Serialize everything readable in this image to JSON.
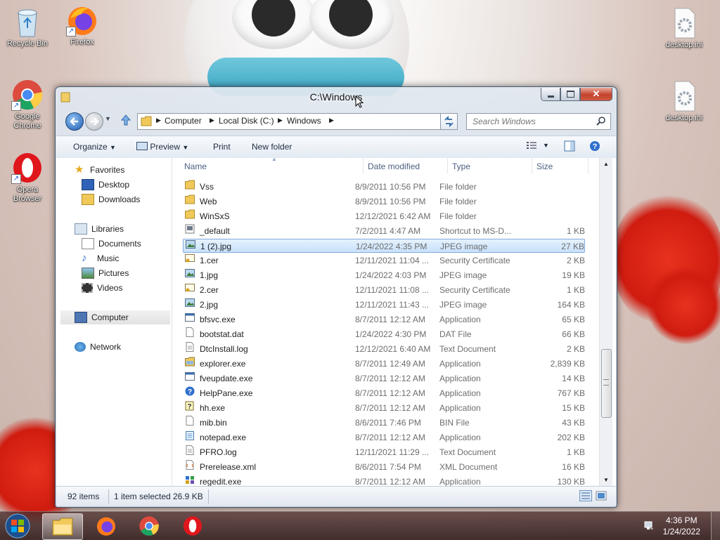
{
  "desktop": {
    "icons": [
      {
        "label": "Recycle Bin"
      },
      {
        "label": "Firefox"
      },
      {
        "label": "Google Chrome"
      },
      {
        "label": "Opera Browser"
      },
      {
        "label": "desktop.ini"
      },
      {
        "label": "desktop.ini"
      }
    ]
  },
  "window": {
    "title": "C:\\Windows",
    "breadcrumb": [
      "Computer",
      "Local Disk (C:)",
      "Windows"
    ],
    "search_placeholder": "Search Windows",
    "toolbar": {
      "organize": "Organize",
      "preview": "Preview",
      "print": "Print",
      "new_folder": "New folder"
    },
    "nav": {
      "favorites": "Favorites",
      "desktop": "Desktop",
      "downloads": "Downloads",
      "libraries": "Libraries",
      "documents": "Documents",
      "music": "Music",
      "pictures": "Pictures",
      "videos": "Videos",
      "computer": "Computer",
      "network": "Network"
    },
    "columns": {
      "name": "Name",
      "date": "Date modified",
      "type": "Type",
      "size": "Size"
    },
    "files": [
      {
        "name": "Vss",
        "date": "8/9/2011 10:56 PM",
        "type": "File folder",
        "size": "",
        "icon": "folder-icon"
      },
      {
        "name": "Web",
        "date": "8/9/2011 10:56 PM",
        "type": "File folder",
        "size": "",
        "icon": "folder-icon"
      },
      {
        "name": "WinSxS",
        "date": "12/12/2021 6:42 AM",
        "type": "File folder",
        "size": "",
        "icon": "folder-icon"
      },
      {
        "name": "_default",
        "date": "7/2/2011 4:47 AM",
        "type": "Shortcut to MS-D...",
        "size": "1 KB",
        "icon": "shortcut-icon"
      },
      {
        "name": "1 (2).jpg",
        "date": "1/24/2022 4:35 PM",
        "type": "JPEG image",
        "size": "27 KB",
        "icon": "image-icon",
        "selected": true
      },
      {
        "name": "1.cer",
        "date": "12/11/2021 11:04 ...",
        "type": "Security Certificate",
        "size": "2 KB",
        "icon": "certificate-icon"
      },
      {
        "name": "1.jpg",
        "date": "1/24/2022 4:03 PM",
        "type": "JPEG image",
        "size": "19 KB",
        "icon": "image-icon"
      },
      {
        "name": "2.cer",
        "date": "12/11/2021 11:08 ...",
        "type": "Security Certificate",
        "size": "1 KB",
        "icon": "certificate-icon"
      },
      {
        "name": "2.jpg",
        "date": "12/11/2021 11:43 ...",
        "type": "JPEG image",
        "size": "164 KB",
        "icon": "image-icon"
      },
      {
        "name": "bfsvc.exe",
        "date": "8/7/2011 12:12 AM",
        "type": "Application",
        "size": "65 KB",
        "icon": "application-icon"
      },
      {
        "name": "bootstat.dat",
        "date": "1/24/2022 4:30 PM",
        "type": "DAT File",
        "size": "66 KB",
        "icon": "file-icon"
      },
      {
        "name": "DtcInstall.log",
        "date": "12/12/2021 6:40 AM",
        "type": "Text Document",
        "size": "2 KB",
        "icon": "text-file-icon"
      },
      {
        "name": "explorer.exe",
        "date": "8/7/2011 12:49 AM",
        "type": "Application",
        "size": "2,839 KB",
        "icon": "explorer-icon"
      },
      {
        "name": "fveupdate.exe",
        "date": "8/7/2011 12:12 AM",
        "type": "Application",
        "size": "14 KB",
        "icon": "application-icon"
      },
      {
        "name": "HelpPane.exe",
        "date": "8/7/2011 12:12 AM",
        "type": "Application",
        "size": "767 KB",
        "icon": "help-icon"
      },
      {
        "name": "hh.exe",
        "date": "8/7/2011 12:12 AM",
        "type": "Application",
        "size": "15 KB",
        "icon": "help-file-icon"
      },
      {
        "name": "mib.bin",
        "date": "8/6/2011 7:46 PM",
        "type": "BIN File",
        "size": "43 KB",
        "icon": "file-icon"
      },
      {
        "name": "notepad.exe",
        "date": "8/7/2011 12:12 AM",
        "type": "Application",
        "size": "202 KB",
        "icon": "notepad-icon"
      },
      {
        "name": "PFRO.log",
        "date": "12/11/2021 11:29 ...",
        "type": "Text Document",
        "size": "1 KB",
        "icon": "text-file-icon"
      },
      {
        "name": "Prerelease.xml",
        "date": "8/6/2011 7:54 PM",
        "type": "XML Document",
        "size": "16 KB",
        "icon": "xml-icon"
      },
      {
        "name": "regedit.exe",
        "date": "8/7/2011 12:12 AM",
        "type": "Application",
        "size": "130 KB",
        "icon": "regedit-icon"
      }
    ],
    "status": {
      "count": "92 items",
      "selected": "1 item selected",
      "selected_size": "26.9 KB"
    }
  },
  "taskbar": {
    "time": "4:36 PM",
    "date": "1/24/2022"
  }
}
